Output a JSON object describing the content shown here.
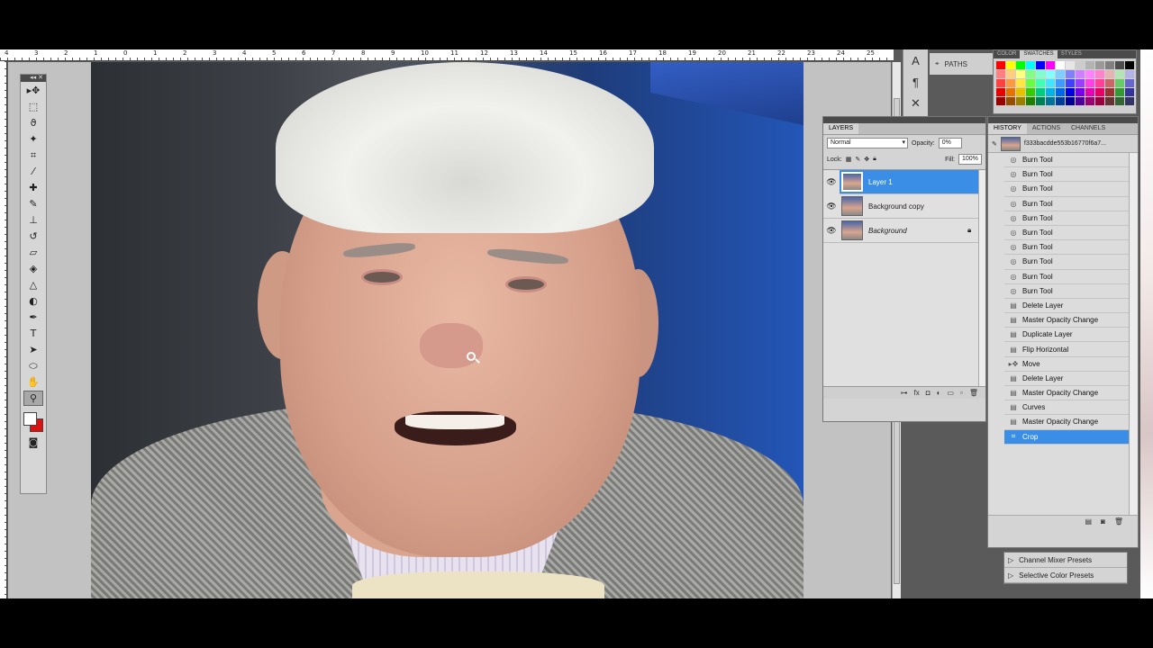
{
  "ruler": {
    "ticks": [
      "4",
      "3",
      "2",
      "1",
      "0",
      "1",
      "2",
      "3",
      "4",
      "5",
      "6",
      "7",
      "8",
      "9",
      "10",
      "11",
      "12",
      "13",
      "14",
      "15",
      "16",
      "17",
      "18",
      "19",
      "20",
      "21",
      "22",
      "23",
      "24",
      "25"
    ]
  },
  "toolbar": {
    "tools": [
      {
        "name": "move-tool-icon",
        "glyph": "▸✥",
        "selected": false
      },
      {
        "name": "marquee-tool-icon",
        "glyph": "⬚",
        "selected": false
      },
      {
        "name": "lasso-tool-icon",
        "glyph": "ϑ",
        "selected": false
      },
      {
        "name": "quick-selection-tool-icon",
        "glyph": "✦",
        "selected": false
      },
      {
        "name": "crop-tool-icon",
        "glyph": "⌗",
        "selected": false
      },
      {
        "name": "eyedropper-tool-icon",
        "glyph": "⁄",
        "selected": false
      },
      {
        "name": "healing-brush-tool-icon",
        "glyph": "✚",
        "selected": false
      },
      {
        "name": "brush-tool-icon",
        "glyph": "✎",
        "selected": false
      },
      {
        "name": "clone-stamp-tool-icon",
        "glyph": "⊥",
        "selected": false
      },
      {
        "name": "history-brush-tool-icon",
        "glyph": "↺",
        "selected": false
      },
      {
        "name": "eraser-tool-icon",
        "glyph": "▱",
        "selected": false
      },
      {
        "name": "paint-bucket-tool-icon",
        "glyph": "◈",
        "selected": false
      },
      {
        "name": "blur-tool-icon",
        "glyph": "△",
        "selected": false
      },
      {
        "name": "dodge-tool-icon",
        "glyph": "◐",
        "selected": false
      },
      {
        "name": "pen-tool-icon",
        "glyph": "✒",
        "selected": false
      },
      {
        "name": "type-tool-icon",
        "glyph": "T",
        "selected": false
      },
      {
        "name": "path-selection-tool-icon",
        "glyph": "➤",
        "selected": false
      },
      {
        "name": "shape-tool-icon",
        "glyph": "⬭",
        "selected": false
      },
      {
        "name": "hand-tool-icon",
        "glyph": "✋",
        "selected": false
      },
      {
        "name": "zoom-tool-icon",
        "glyph": "⚲",
        "selected": true
      }
    ],
    "foreground": "#ffffff",
    "background": "#e01010",
    "quick_mask_glyph": "◙"
  },
  "dock": {
    "icons": [
      "A",
      "¶",
      "✕"
    ],
    "paths_label": "PATHS"
  },
  "swatch_panel": {
    "tabs": [
      "COLOR",
      "SWATCHES",
      "STYLES"
    ],
    "active_tab": "SWATCHES",
    "colors": [
      "#ff0000",
      "#ffff00",
      "#00ff00",
      "#00ffff",
      "#0000ff",
      "#ff00ff",
      "#ffffff",
      "#e6e6e6",
      "#cccccc",
      "#b3b3b3",
      "#999999",
      "#808080",
      "#4d4d4d",
      "#000000",
      "#ff8080",
      "#ffcc80",
      "#ffff80",
      "#80ff80",
      "#80ffcc",
      "#80ffff",
      "#80ccff",
      "#8080ff",
      "#cc80ff",
      "#ff80ff",
      "#ff80cc",
      "#e6b3b3",
      "#b3e6b3",
      "#b3b3e6",
      "#ff4040",
      "#ff9940",
      "#ffe640",
      "#66ff40",
      "#40ffb3",
      "#40e6ff",
      "#4099ff",
      "#4040ff",
      "#9940ff",
      "#ff40e6",
      "#ff4099",
      "#cc6666",
      "#66cc66",
      "#6666cc",
      "#e60000",
      "#e67300",
      "#e6c300",
      "#33cc00",
      "#00cc80",
      "#00b3e6",
      "#0066e6",
      "#0000e6",
      "#7300e6",
      "#e600b3",
      "#e60066",
      "#993333",
      "#339933",
      "#333399",
      "#990000",
      "#994d00",
      "#998000",
      "#1f8000",
      "#008055",
      "#007399",
      "#003d99",
      "#000099",
      "#4d0099",
      "#990073",
      "#990040",
      "#663333",
      "#336633",
      "#333366"
    ]
  },
  "layers_panel": {
    "tabs": [
      "LAYERS"
    ],
    "blend_mode": "Normal",
    "opacity_label": "Opacity:",
    "opacity_value": "0%",
    "lock_label": "Lock:",
    "fill_label": "Fill:",
    "fill_value": "100%",
    "layers": [
      {
        "name": "Layer 1",
        "selected": true,
        "italic": false,
        "locked": false
      },
      {
        "name": "Background copy",
        "selected": false,
        "italic": false,
        "locked": false
      },
      {
        "name": "Background",
        "selected": false,
        "italic": true,
        "locked": true
      }
    ],
    "footer_icons": [
      "link-icon",
      "fx-icon",
      "mask-icon",
      "adjustment-icon",
      "group-icon",
      "new-layer-icon",
      "trash-icon"
    ]
  },
  "history_panel": {
    "tabs": [
      "HISTORY",
      "ACTIONS",
      "CHANNELS"
    ],
    "active_tab": "HISTORY",
    "snapshot_name": "f333bacdde553b16770f6a7...",
    "items": [
      {
        "label": "Burn Tool",
        "icon": "burn"
      },
      {
        "label": "Burn Tool",
        "icon": "burn"
      },
      {
        "label": "Burn Tool",
        "icon": "burn"
      },
      {
        "label": "Burn Tool",
        "icon": "burn"
      },
      {
        "label": "Burn Tool",
        "icon": "burn"
      },
      {
        "label": "Burn Tool",
        "icon": "burn"
      },
      {
        "label": "Burn Tool",
        "icon": "burn"
      },
      {
        "label": "Burn Tool",
        "icon": "burn"
      },
      {
        "label": "Burn Tool",
        "icon": "burn"
      },
      {
        "label": "Burn Tool",
        "icon": "burn"
      },
      {
        "label": "Delete Layer",
        "icon": "doc"
      },
      {
        "label": "Master Opacity Change",
        "icon": "doc"
      },
      {
        "label": "Duplicate Layer",
        "icon": "doc"
      },
      {
        "label": "Flip Horizontal",
        "icon": "doc"
      },
      {
        "label": "Move",
        "icon": "move"
      },
      {
        "label": "Delete Layer",
        "icon": "doc"
      },
      {
        "label": "Master Opacity Change",
        "icon": "doc"
      },
      {
        "label": "Curves",
        "icon": "doc"
      },
      {
        "label": "Master Opacity Change",
        "icon": "doc"
      },
      {
        "label": "Crop",
        "icon": "crop",
        "selected": true
      }
    ]
  },
  "presets_panel": {
    "items": [
      "Channel Mixer Presets",
      "Selective Color Presets"
    ]
  }
}
